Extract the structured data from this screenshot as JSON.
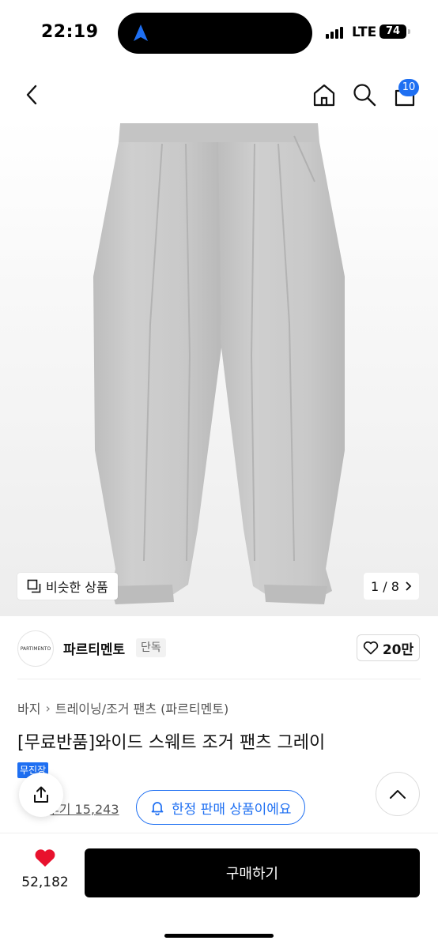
{
  "status_bar": {
    "time": "22:19",
    "network": "LTE",
    "battery": "74"
  },
  "top_nav": {
    "cart_count": "10"
  },
  "gallery": {
    "similar_label": "비슷한 상품",
    "page_indicator": "1 / 8",
    "image_color": "#c8c8c8"
  },
  "brand": {
    "logo_text": "PARTIMENTO",
    "name": "파르티멘토",
    "tag": "단독",
    "likes": "20만"
  },
  "product": {
    "breadcrumb": [
      "바지",
      "트레이닝/조거 팬츠 (파르티멘토)"
    ],
    "title": "[무료반품]와이드 스웨트 조거 팬츠 그레이",
    "exclusive_badge": "무진장",
    "review_label": "후기 15,243"
  },
  "limited_notice": "한정 판매 상품이에요",
  "bottom_bar": {
    "wish_count": "52,182",
    "buy_label": "구매하기"
  },
  "colors": {
    "accent": "#1e6ff2",
    "heart": "#e8112d"
  }
}
